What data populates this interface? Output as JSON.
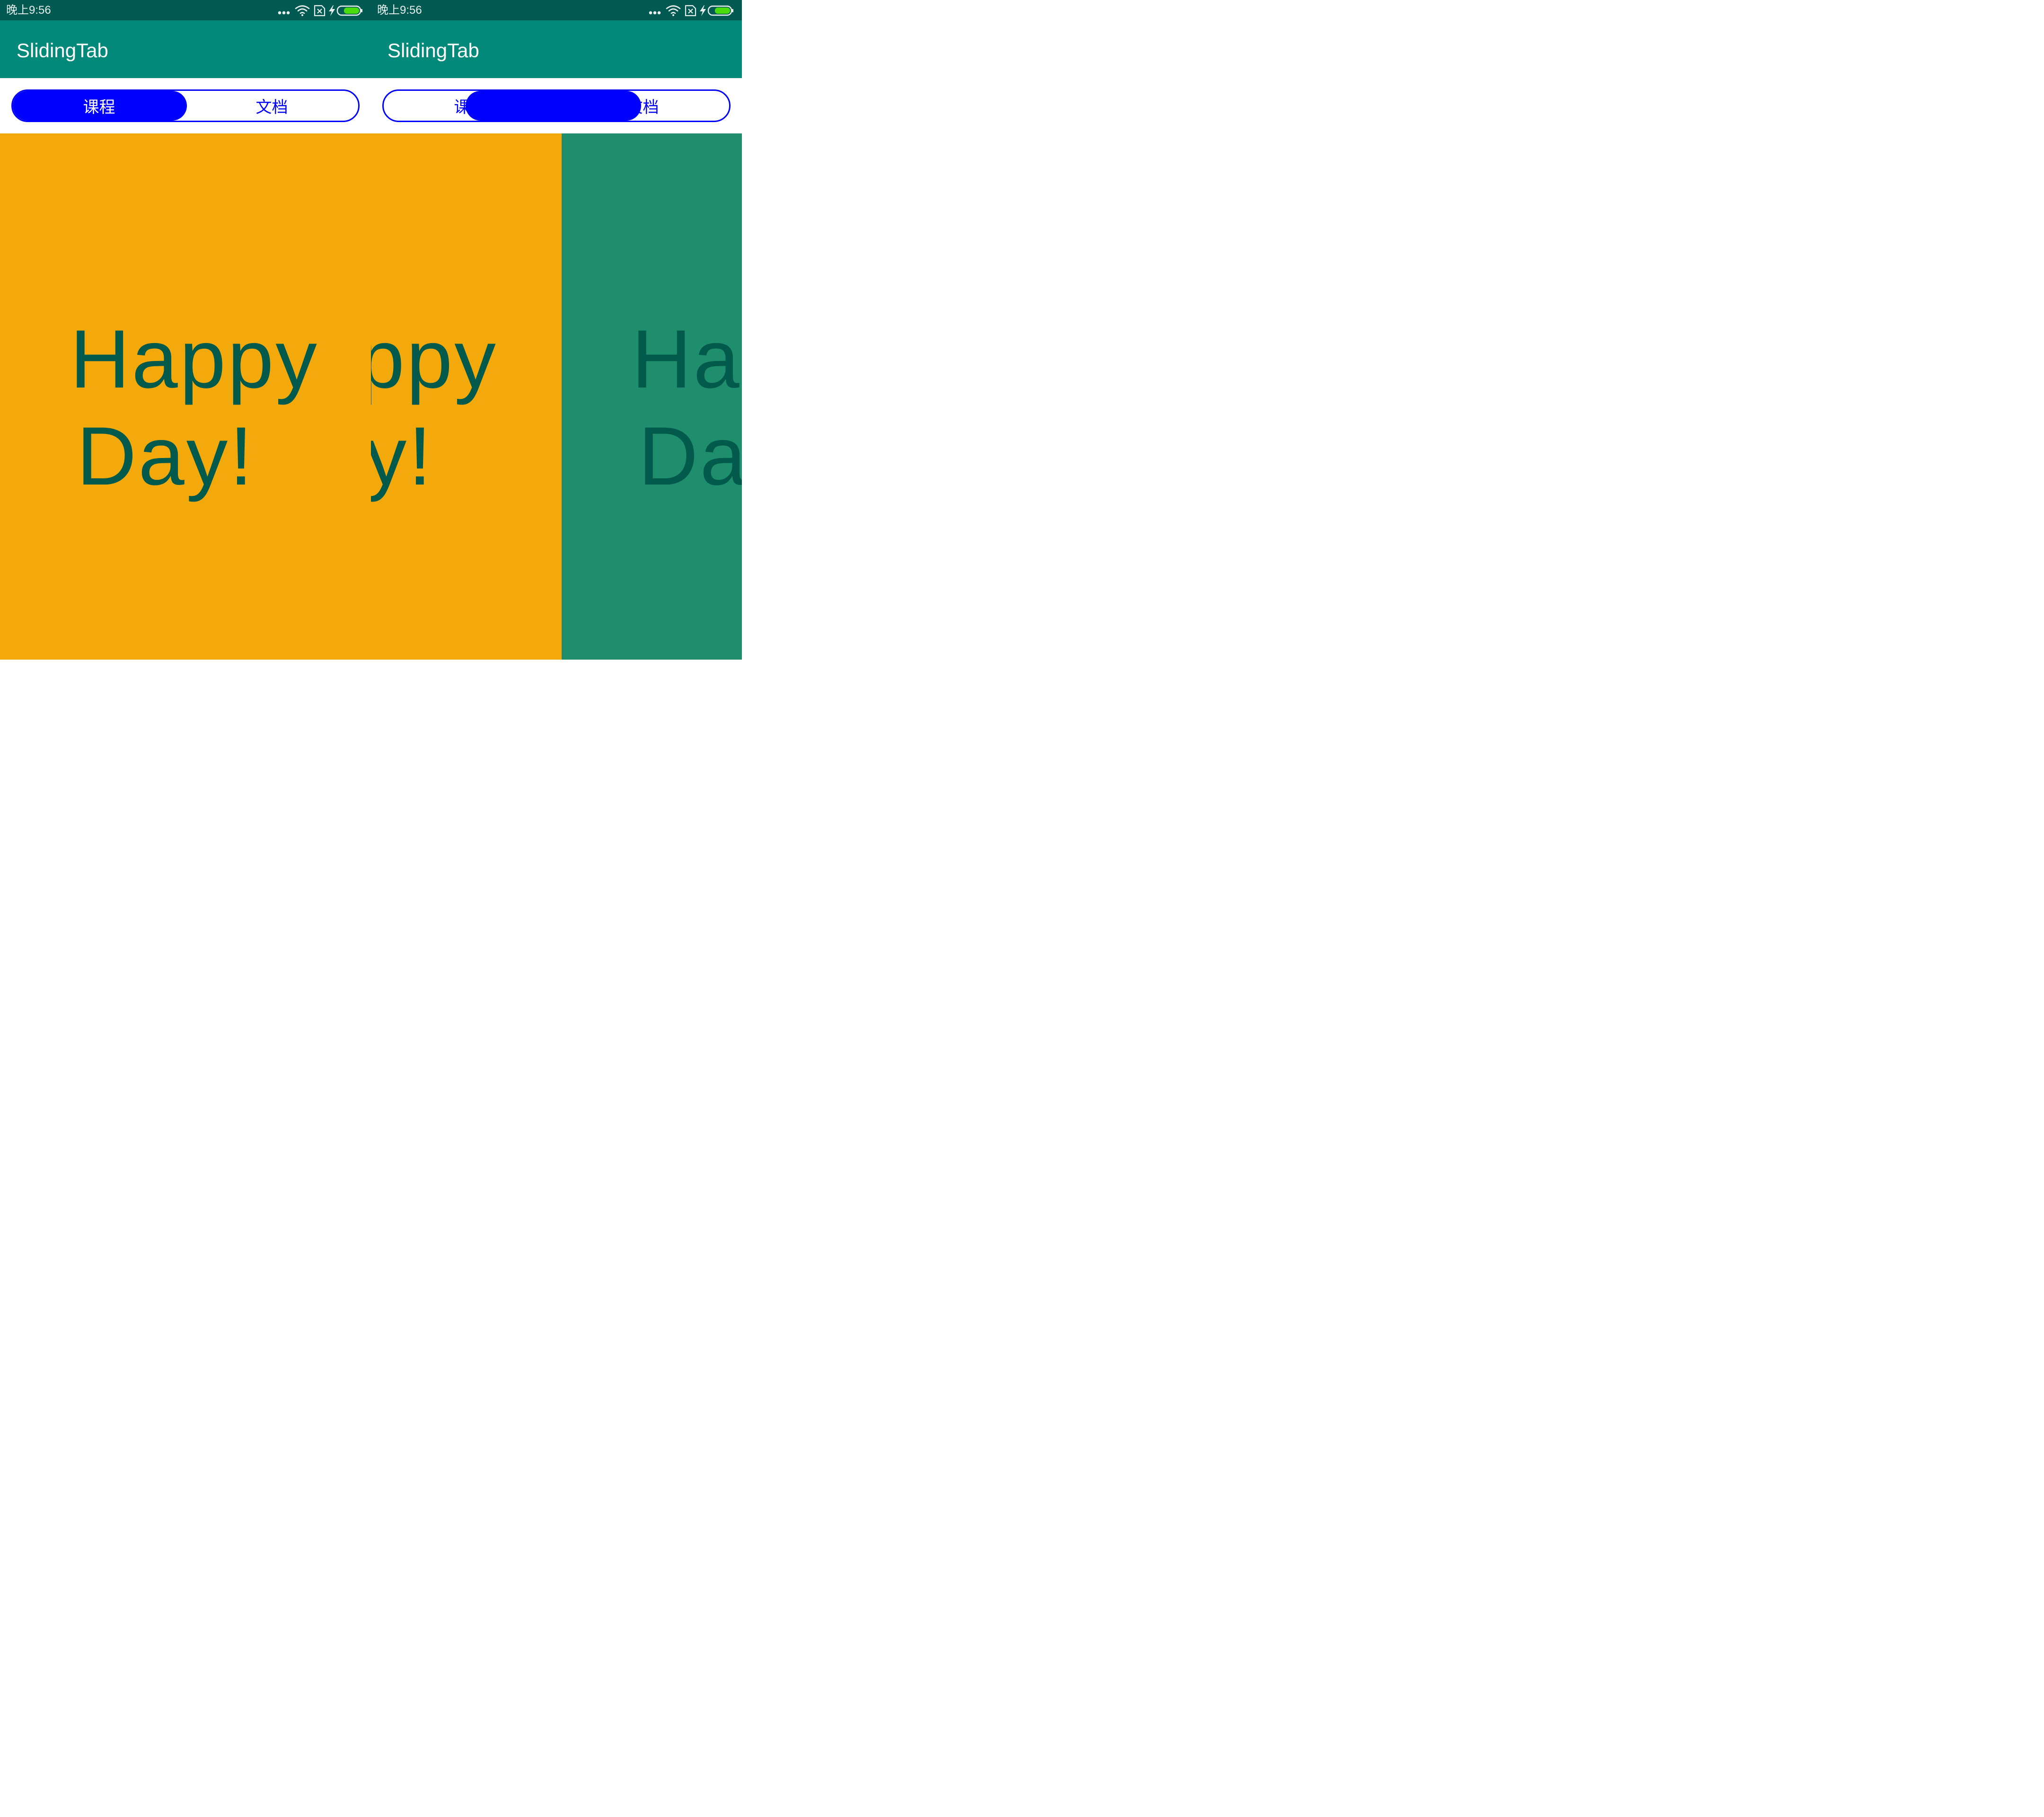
{
  "status_bar": {
    "time": "晚上9:56",
    "icons": [
      "more-dots-icon",
      "wifi-icon",
      "sim-disabled-icon",
      "charging-bolt-icon",
      "battery-icon"
    ]
  },
  "app_bar": {
    "title": "SlidingTab"
  },
  "tabs": [
    {
      "label": "课程"
    },
    {
      "label": "文档"
    }
  ],
  "pages": [
    {
      "line1": "Happy",
      "line2": "Day!",
      "color": "#f3a90b"
    },
    {
      "line1": "Happy",
      "line2": "Day!",
      "color": "#1f8e6c"
    }
  ],
  "colors": {
    "status_bar": "#015a51",
    "app_bar": "#02897a",
    "tab_accent": "#0000ff",
    "text": "#015a4b"
  }
}
